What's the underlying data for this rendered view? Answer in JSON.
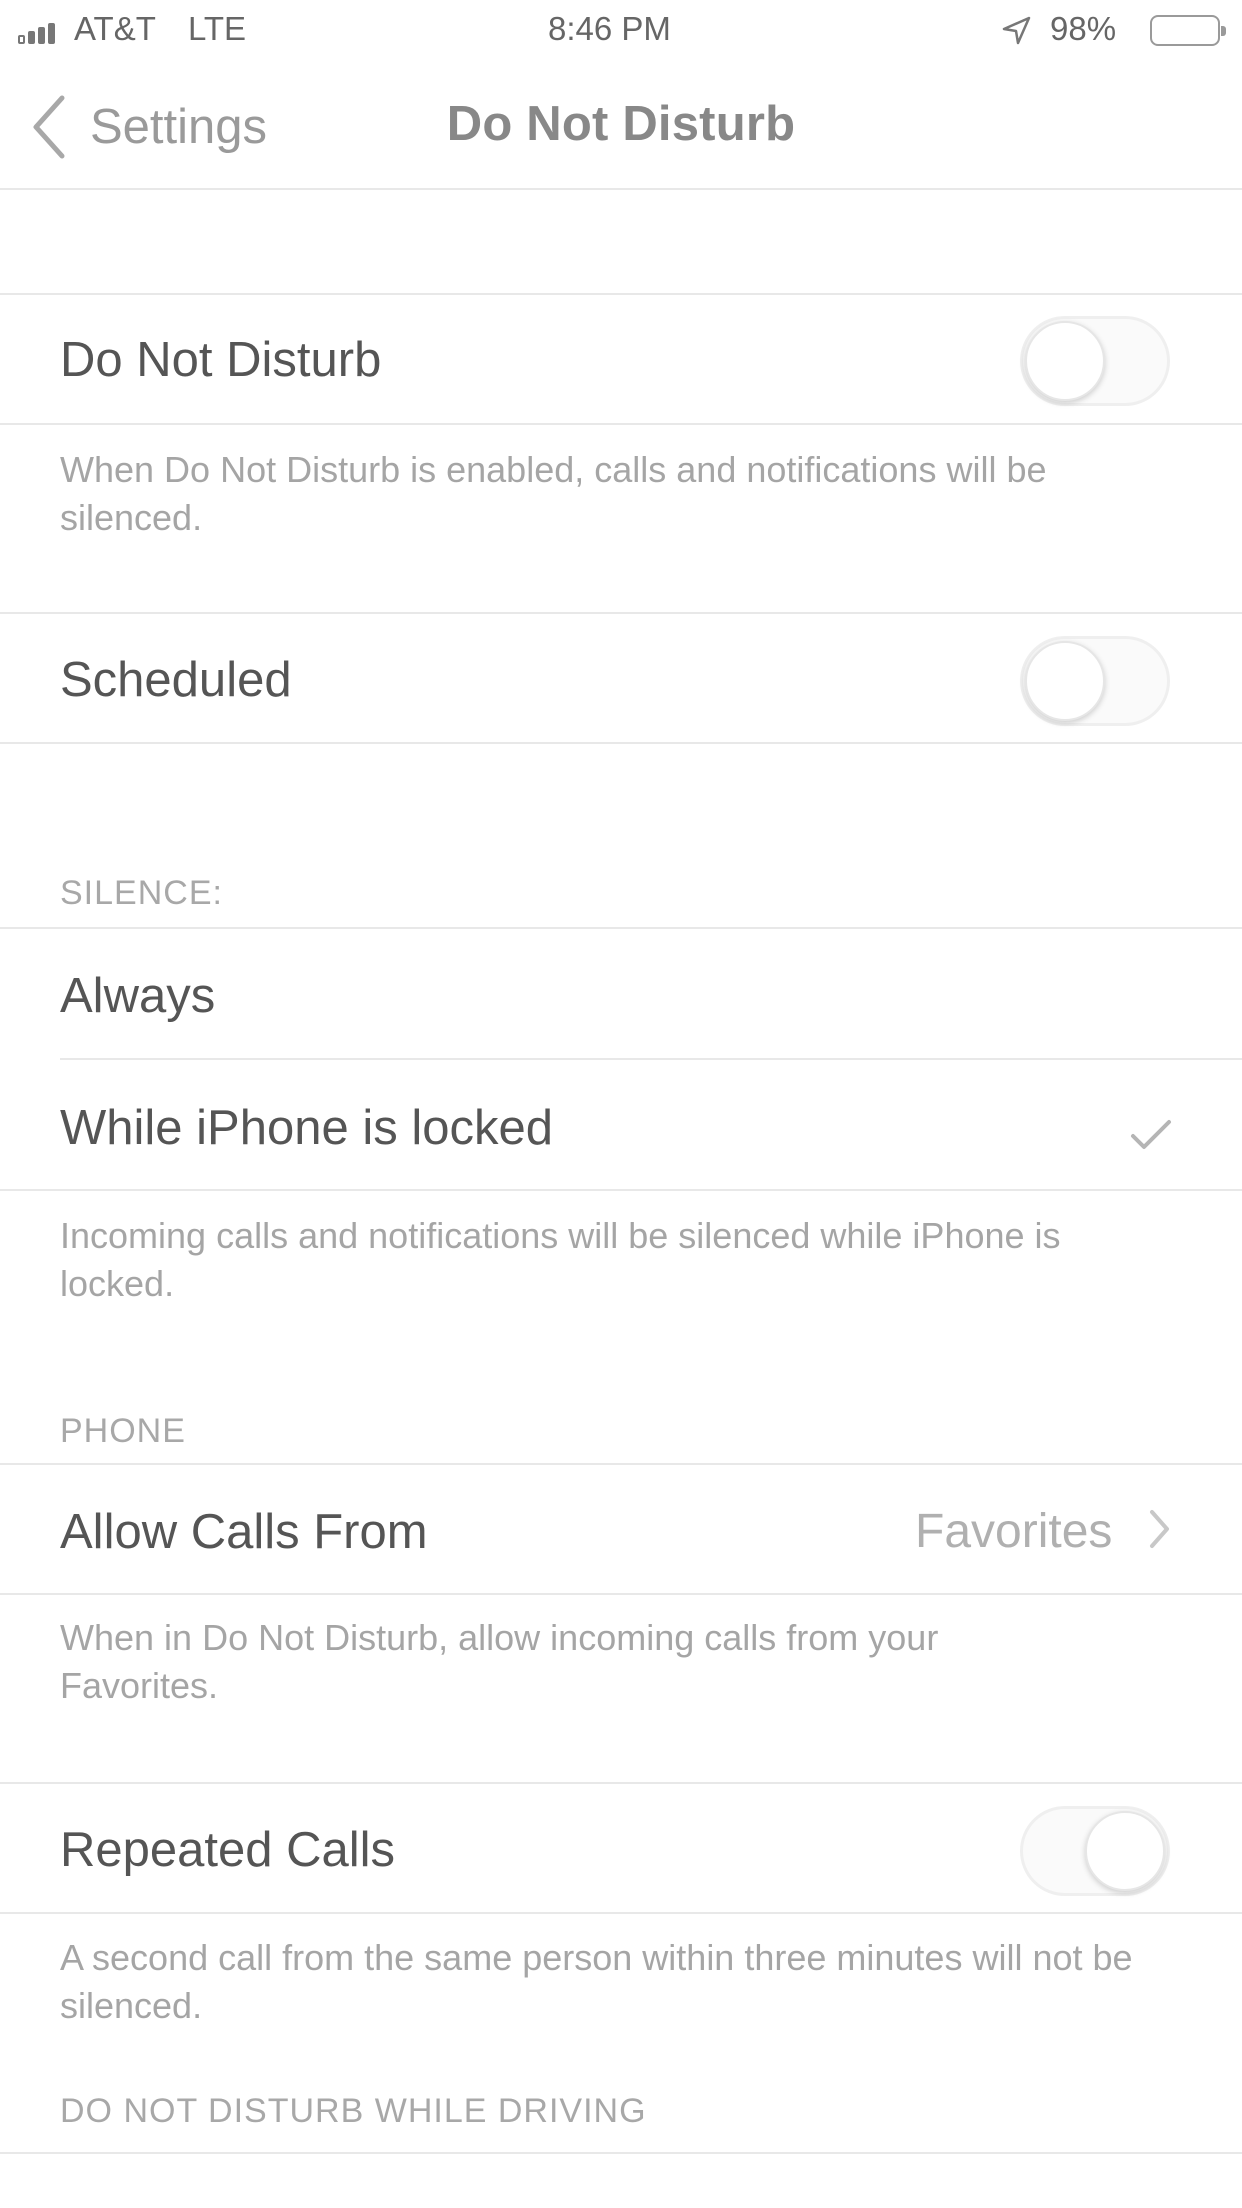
{
  "status_bar": {
    "carrier": "AT&T",
    "network": "LTE",
    "time": "8:46 PM",
    "battery": "98%",
    "battery_level": 0.98,
    "icons": [
      "signal-icon",
      "location-arrow-icon",
      "battery-icon"
    ]
  },
  "nav": {
    "back_label": "Settings",
    "title": "Do Not Disturb"
  },
  "dnd": {
    "label": "Do Not Disturb",
    "enabled": false,
    "footer": "When Do Not Disturb is enabled, calls and notifications will be silenced."
  },
  "scheduled": {
    "label": "Scheduled",
    "enabled": false
  },
  "silence": {
    "header": "SILENCE:",
    "options": [
      "Always",
      "While iPhone is locked"
    ],
    "selected": "While iPhone is locked",
    "footer": "Incoming calls and notifications will be silenced while iPhone is locked."
  },
  "phone": {
    "header": "PHONE",
    "allow_calls_label": "Allow Calls From",
    "allow_calls_value": "Favorites",
    "allow_calls_footer": "When in Do Not Disturb, allow incoming calls from your Favorites.",
    "repeated_label": "Repeated Calls",
    "repeated_enabled": true,
    "repeated_footer": "A second call from the same person within three minutes will not be silenced."
  },
  "driving": {
    "header": "DO NOT DISTURB WHILE DRIVING"
  },
  "colors": {
    "background": "#ffffff",
    "separator": "#e8e8e8",
    "text": "#555555",
    "secondary_text": "#a5a5a5"
  }
}
